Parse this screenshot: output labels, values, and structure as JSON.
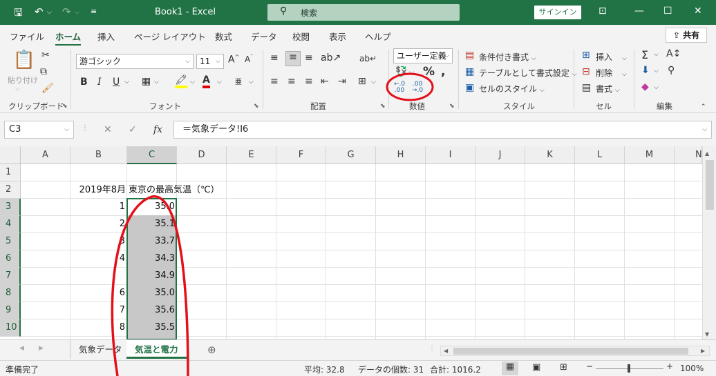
{
  "window": {
    "title": "Book1  -  Excel",
    "search_label": "検索",
    "signin_label": "サインイン"
  },
  "tabs": [
    {
      "label": "ファイル"
    },
    {
      "label": "ホーム"
    },
    {
      "label": "挿入"
    },
    {
      "label": "ページ レイアウト"
    },
    {
      "label": "数式"
    },
    {
      "label": "データ"
    },
    {
      "label": "校閲"
    },
    {
      "label": "表示"
    },
    {
      "label": "ヘルプ"
    }
  ],
  "share_label": "共有",
  "ribbon": {
    "clipboard": {
      "paste_label": "貼り付け",
      "group": "クリップボード"
    },
    "font": {
      "name": "游ゴシック",
      "size": "11",
      "group": "フォント"
    },
    "alignment": {
      "group": "配置"
    },
    "number": {
      "format": "ユーザー定義",
      "group": "数値"
    },
    "styles": {
      "conditional": "条件付き書式",
      "table": "テーブルとして書式設定",
      "cell_style": "セルのスタイル",
      "group": "スタイル"
    },
    "cells": {
      "insert": "挿入",
      "delete": "削除",
      "format": "書式",
      "group": "セル"
    },
    "editing": {
      "group": "編集"
    }
  },
  "formula_bar": {
    "name_box": "C3",
    "formula": "＝気象データ!I6",
    "fx": "fx"
  },
  "columns": [
    "A",
    "B",
    "C",
    "D",
    "E",
    "F",
    "G",
    "H",
    "I",
    "J",
    "K",
    "L",
    "M",
    "N"
  ],
  "rows": [
    "1",
    "2",
    "3",
    "4",
    "5",
    "6",
    "7",
    "8",
    "9",
    "10"
  ],
  "cells": {
    "b2": "2019年8月",
    "c2": "東京の最高気温（℃）",
    "b_values": [
      "1",
      "2",
      "3",
      "4",
      "",
      "6",
      "7",
      "8"
    ],
    "c_values": [
      "35.0",
      "35.1",
      "33.7",
      "34.3",
      "34.9",
      "35.0",
      "35.6",
      "35.5"
    ]
  },
  "sheets": [
    {
      "label": "気象データ"
    },
    {
      "label": "気温と電力"
    }
  ],
  "status": {
    "ready": "準備完了",
    "average": "平均: 32.8",
    "count": "データの個数: 31",
    "sum": "合計: 1016.2",
    "zoom": "100%"
  },
  "accent": "#217346"
}
